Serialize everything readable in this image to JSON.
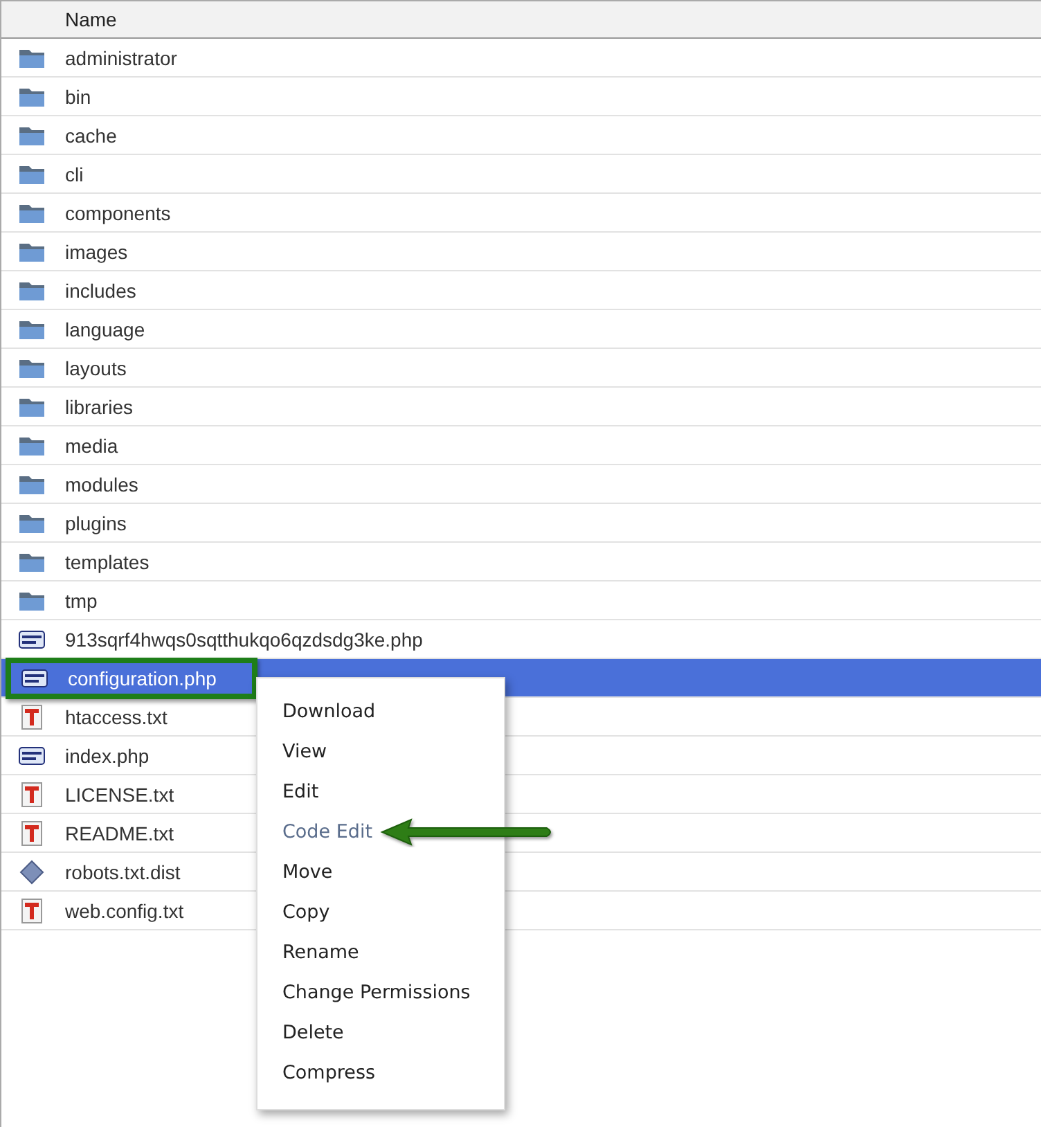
{
  "table": {
    "columns": [
      "Name"
    ],
    "rows": [
      {
        "name": "administrator",
        "kind": "folder",
        "selected": false
      },
      {
        "name": "bin",
        "kind": "folder",
        "selected": false
      },
      {
        "name": "cache",
        "kind": "folder",
        "selected": false
      },
      {
        "name": "cli",
        "kind": "folder",
        "selected": false
      },
      {
        "name": "components",
        "kind": "folder",
        "selected": false
      },
      {
        "name": "images",
        "kind": "folder",
        "selected": false
      },
      {
        "name": "includes",
        "kind": "folder",
        "selected": false
      },
      {
        "name": "language",
        "kind": "folder",
        "selected": false
      },
      {
        "name": "layouts",
        "kind": "folder",
        "selected": false
      },
      {
        "name": "libraries",
        "kind": "folder",
        "selected": false
      },
      {
        "name": "media",
        "kind": "folder",
        "selected": false
      },
      {
        "name": "modules",
        "kind": "folder",
        "selected": false
      },
      {
        "name": "plugins",
        "kind": "folder",
        "selected": false
      },
      {
        "name": "templates",
        "kind": "folder",
        "selected": false
      },
      {
        "name": "tmp",
        "kind": "folder",
        "selected": false
      },
      {
        "name": "913sqrf4hwqs0sqtthukqo6qzdsdg3ke.php",
        "kind": "php",
        "selected": false
      },
      {
        "name": "configuration.php",
        "kind": "php",
        "selected": true
      },
      {
        "name": "htaccess.txt",
        "kind": "text",
        "selected": false
      },
      {
        "name": "index.php",
        "kind": "php",
        "selected": false
      },
      {
        "name": "LICENSE.txt",
        "kind": "text",
        "selected": false
      },
      {
        "name": "README.txt",
        "kind": "text",
        "selected": false
      },
      {
        "name": "robots.txt.dist",
        "kind": "other",
        "selected": false
      },
      {
        "name": "web.config.txt",
        "kind": "text",
        "selected": false
      }
    ]
  },
  "context_menu": {
    "items": [
      {
        "label": "Download",
        "selected": false
      },
      {
        "label": "View",
        "selected": false
      },
      {
        "label": "Edit",
        "selected": false
      },
      {
        "label": "Code Edit",
        "selected": true
      },
      {
        "label": "Move",
        "selected": false
      },
      {
        "label": "Copy",
        "selected": false
      },
      {
        "label": "Rename",
        "selected": false
      },
      {
        "label": "Change Permissions",
        "selected": false
      },
      {
        "label": "Delete",
        "selected": false
      },
      {
        "label": "Compress",
        "selected": false
      }
    ]
  }
}
